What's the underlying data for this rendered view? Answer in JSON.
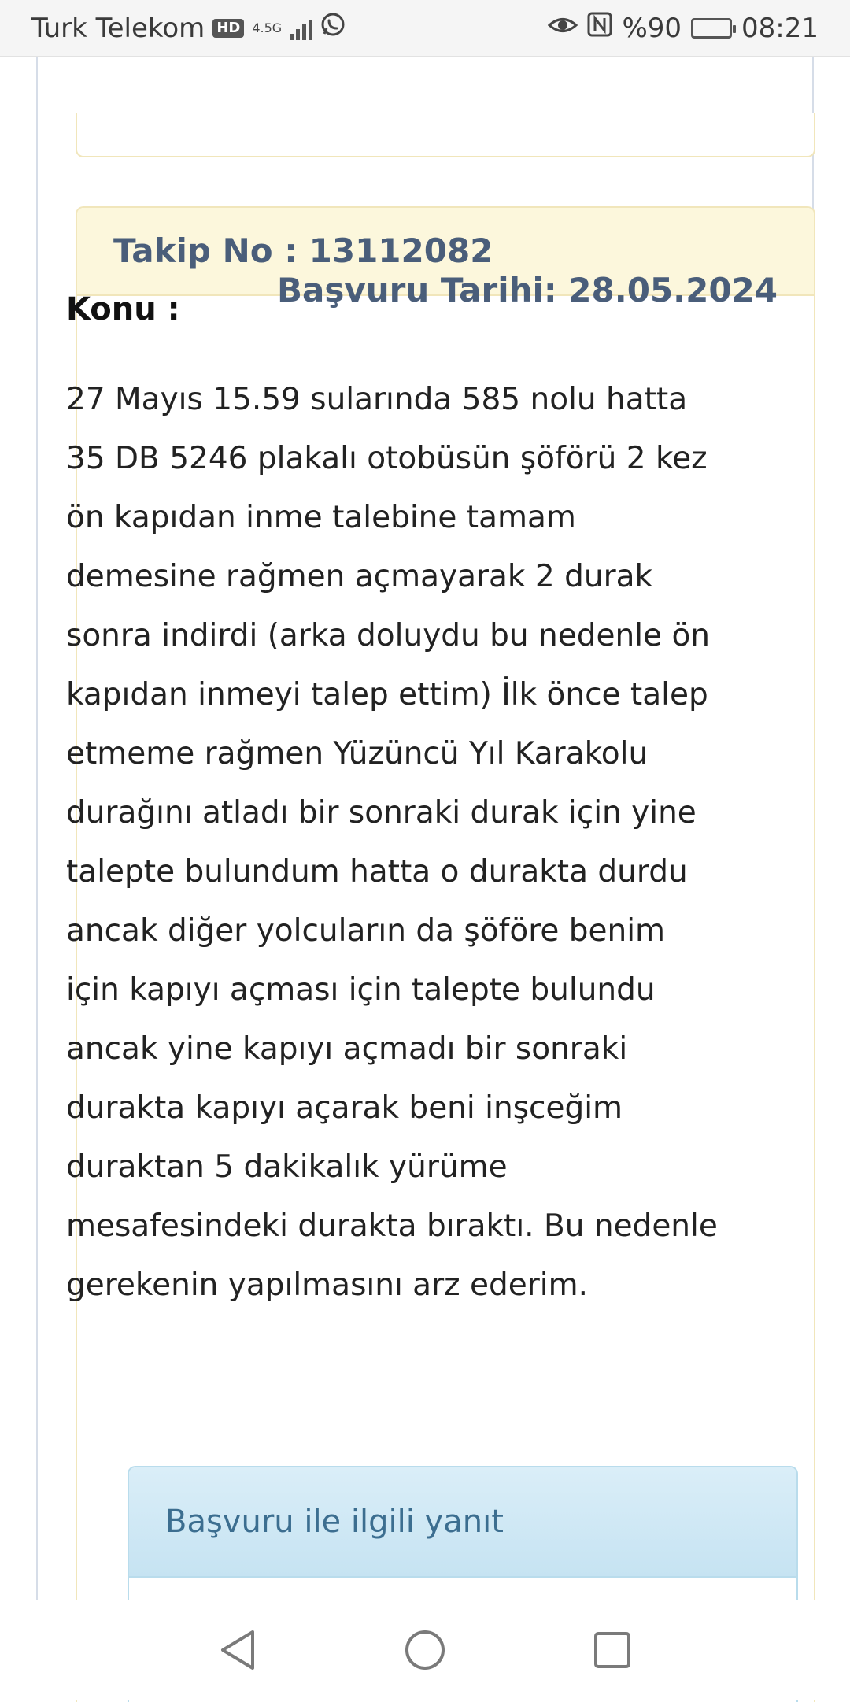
{
  "status_bar": {
    "carrier": "Turk Telekom",
    "hd_badge": "HD",
    "network": "4.5G",
    "battery": "%90",
    "time": "08:21",
    "icons": [
      "hd-icon",
      "signal-icon",
      "whatsapp-icon",
      "eye-icon",
      "nfc-icon",
      "battery-icon"
    ]
  },
  "card": {
    "tracking": "Takip No : 13112082",
    "application_date": "Başvuru Tarihi: 28.05.2024",
    "subject_label": "Konu :",
    "subject_text": "27 Mayıs 15.59 sularında 585 nolu hatta 35 DB 5246 plakalı otobüsün şöförü 2 kez ön kapıdan inme talebine tamam demesine rağmen açmayarak 2 durak sonra indirdi (arka doluydu bu nedenle ön kapıdan inmeyi talep ettim) İlk önce talep etmeme rağmen Yüzüncü Yıl Karakolu durağını atladı bir sonraki durak için yine talepte bulundum hatta o durakta durdu ancak diğer yolcuların da şöföre benim için kapıyı açması için talepte bulundu ancak yine kapıyı açmadı bir sonraki durakta kapıyı açarak beni inşceğim duraktan 5 dakikalık yürüme mesafesindeki durakta bıraktı. Bu nedenle gerekenin yapılmasını arz ederim."
  },
  "response": {
    "title": "Başvuru ile ilgili yanıt"
  },
  "nav": {
    "icons": [
      "back-icon",
      "home-icon",
      "recents-icon"
    ]
  },
  "colors": {
    "card_header_bg": "#fcf7dc",
    "card_border": "#f1e6bb",
    "header_text": "#4a5e7a",
    "response_header_bg": "#c6e3f2",
    "response_title": "#3c6e90"
  }
}
